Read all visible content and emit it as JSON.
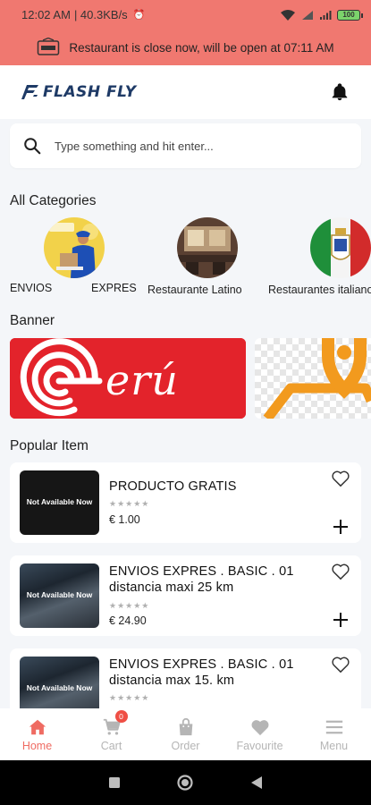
{
  "status_bar": {
    "time": "12:02 AM",
    "speed": "| 40.3KB/s",
    "battery": "100"
  },
  "notice": {
    "text": "Restaurant is close now, will be open at 07:11 AM"
  },
  "header": {
    "logo_text": "FLASH FLY"
  },
  "search": {
    "placeholder": "Type something and hit enter..."
  },
  "sections": {
    "categories": "All Categories",
    "banner": "Banner",
    "popular": "Popular Item"
  },
  "categories": [
    {
      "label": "ENVIOS",
      "label2": "EXPRES"
    },
    {
      "label": "Restaurante Latino"
    },
    {
      "label": "Restaurantes italianos"
    }
  ],
  "banners": [
    {
      "text": "erú"
    }
  ],
  "products": [
    {
      "title": "PRODUCTO GRATIS",
      "price": "€ 1.00",
      "stars": "★★★★★",
      "thumb_text": "Not Available Now"
    },
    {
      "title": "ENVIOS  EXPRES . BASIC . 01 distancia  maxi 25 km",
      "price": "€ 24.90",
      "stars": "★★★★★",
      "thumb_text": "Not Available Now"
    },
    {
      "title": "ENVIOS  EXPRES . BASIC . 01 distancia  max 15. km",
      "price": "",
      "stars": "★★★★★",
      "thumb_text": "Not Available Now"
    }
  ],
  "bottom_nav": [
    {
      "label": "Home",
      "icon": "home-icon",
      "active": true
    },
    {
      "label": "Cart",
      "icon": "cart-icon",
      "badge": "0"
    },
    {
      "label": "Order",
      "icon": "bag-icon"
    },
    {
      "label": "Favourite",
      "icon": "heart-icon"
    },
    {
      "label": "Menu",
      "icon": "menu-icon"
    }
  ],
  "colors": {
    "accent": "#ef6b62",
    "notice_bg": "#f07870",
    "logo": "#1e3a66",
    "peru_red": "#e3232b",
    "map_orange": "#f29a1e"
  }
}
